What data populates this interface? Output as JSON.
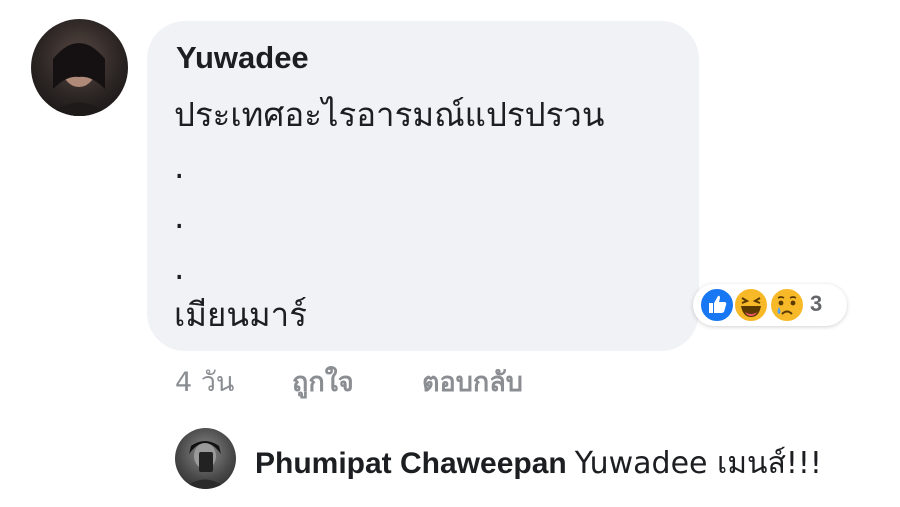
{
  "comment": {
    "author": "Yuwadee",
    "lines": [
      "ประเทศอะไรอารมณ์แปรปรวน",
      ".",
      ".",
      ".",
      "เมียนมาร์"
    ]
  },
  "reactions": {
    "icons": [
      "like-icon",
      "haha-icon",
      "sad-icon"
    ],
    "count": "3",
    "colors": {
      "like": "#1877f2",
      "haha": "#f7b928",
      "sad": "#f7b928"
    }
  },
  "meta": {
    "time": "4 วัน",
    "like_label": "ถูกใจ",
    "reply_label": "ตอบกลับ"
  },
  "reply": {
    "author": "Phumipat Chaweepan",
    "text": "Yuwadee เมนส์!!!"
  }
}
